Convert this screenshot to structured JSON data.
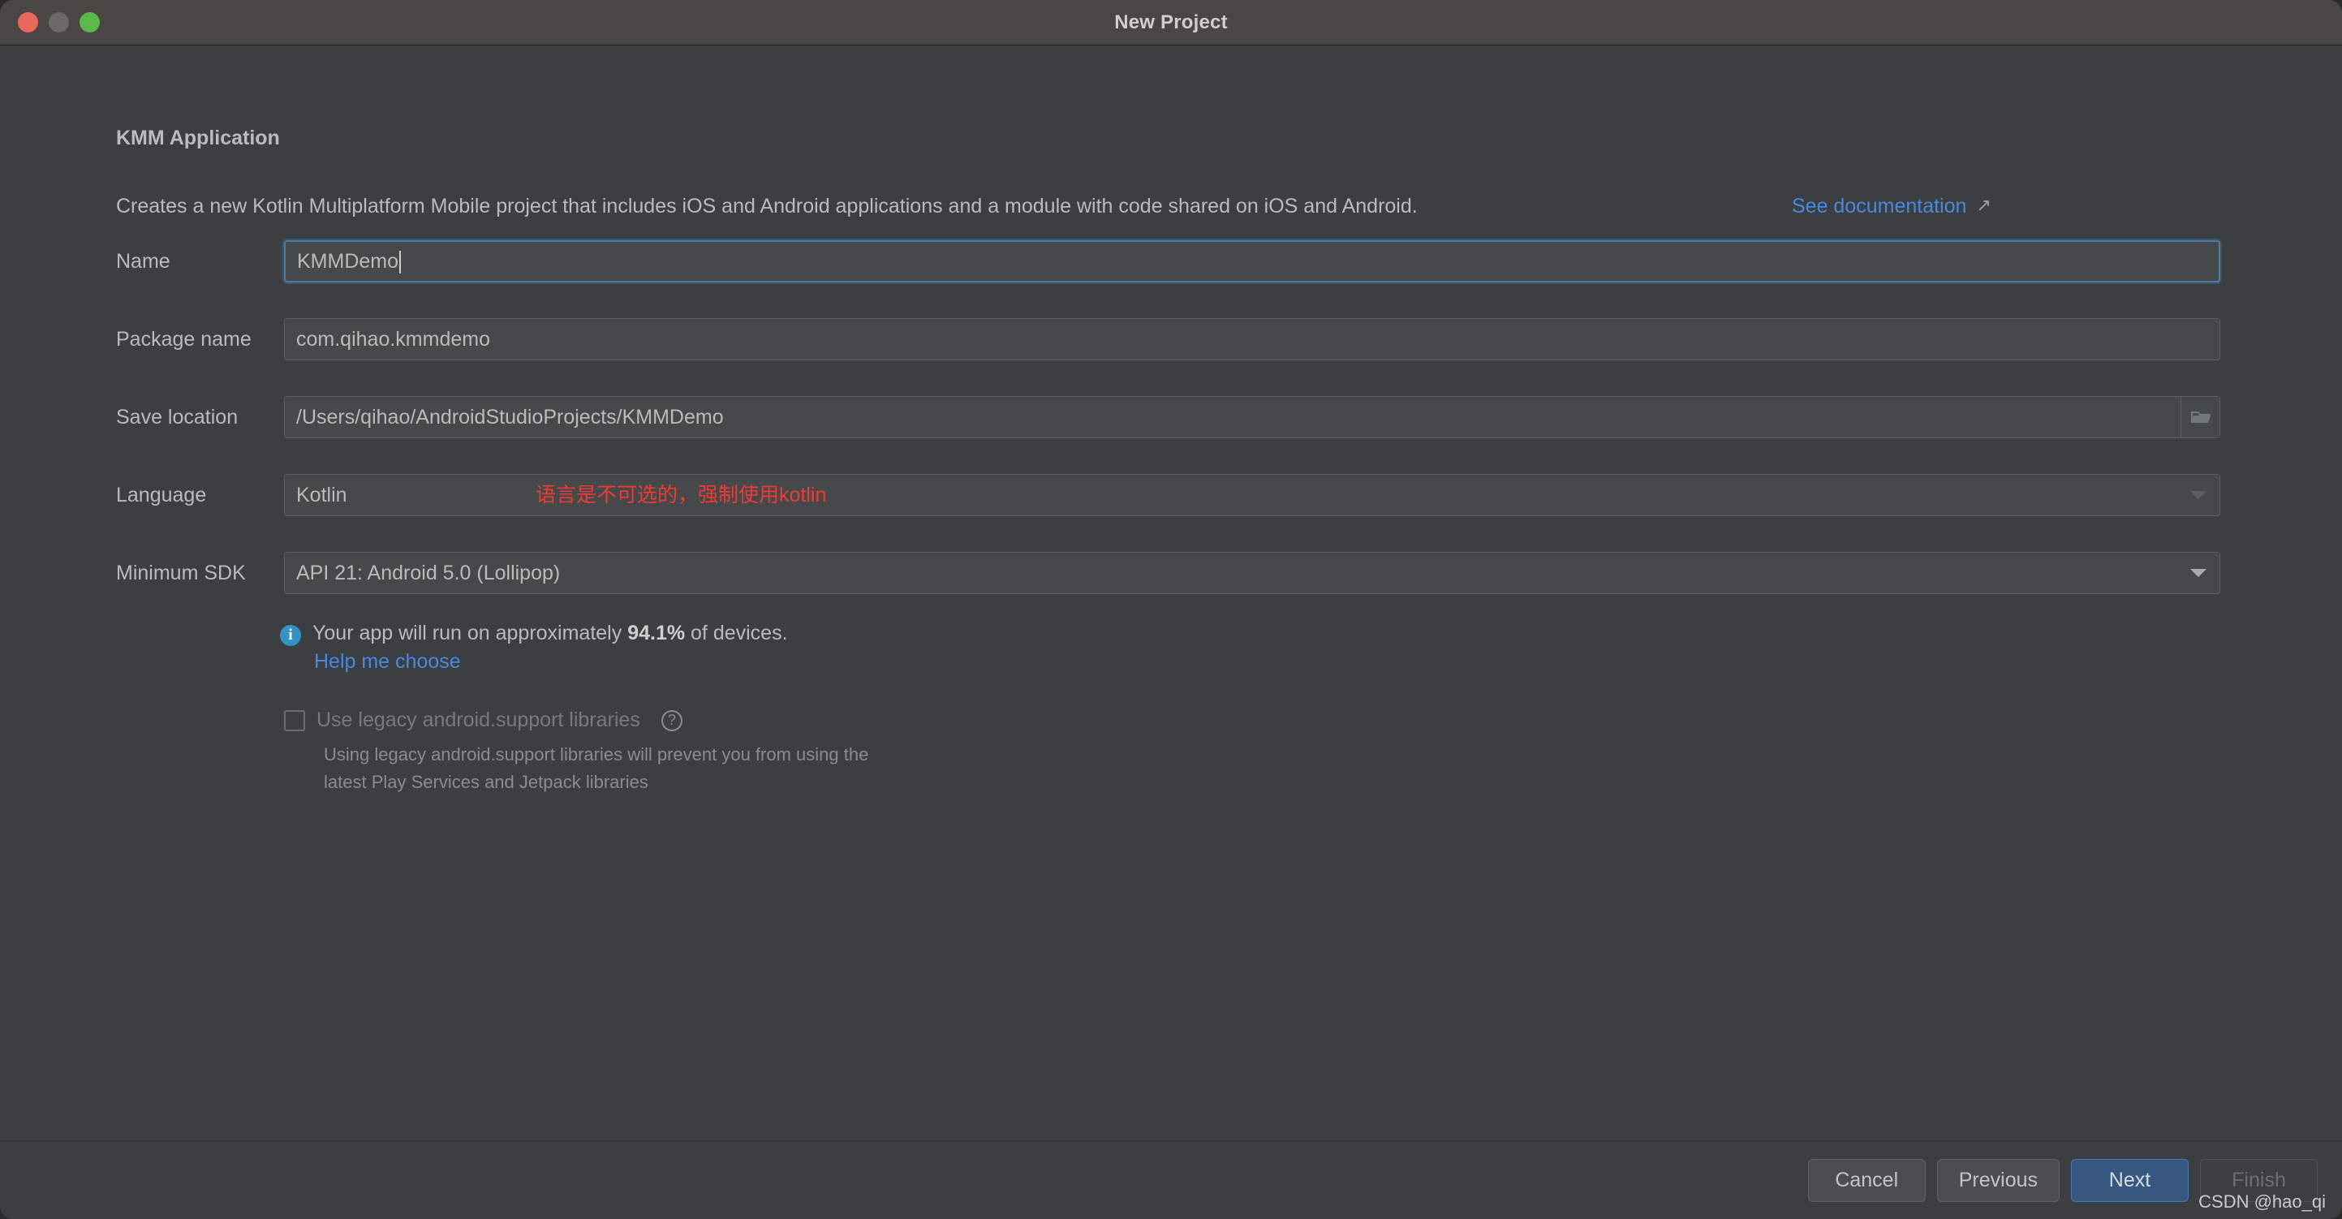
{
  "window": {
    "title": "New Project",
    "controls": {
      "close": "close-button",
      "minimize": "minimize-button",
      "maximize": "maximize-button"
    }
  },
  "page": {
    "title": "KMM Application",
    "description": "Creates a new Kotlin Multiplatform Mobile project that includes iOS and Android applications and a module with code shared on iOS and Android.",
    "doc_link": "See documentation",
    "doc_link_icon": "external-link-arrow"
  },
  "form": {
    "name": {
      "label": "Name",
      "value": "KMMDemo",
      "placeholder": "Name"
    },
    "package_name": {
      "label": "Package name",
      "value": "com.qihao.kmmdemo",
      "placeholder": "Package name"
    },
    "save_location": {
      "label": "Save location",
      "value": "/Users/qihao/AndroidStudioProjects/KMMDemo",
      "placeholder": "Save location",
      "browse_icon": "folder-icon"
    },
    "language": {
      "label": "Language",
      "value": "Kotlin",
      "options": [
        "Kotlin"
      ],
      "annotation": "语言是不可选的，强制使用kotlin",
      "annotation_color": "#f03a35",
      "disabled": true
    },
    "minimum_sdk": {
      "label": "Minimum SDK",
      "value": "API 21: Android 5.0 (Lollipop)",
      "options": [
        "API 21: Android 5.0 (Lollipop)"
      ]
    }
  },
  "info": {
    "icon": "info-icon",
    "text_before": "Your app will run on approximately ",
    "percent": "94.1%",
    "text_after": " of devices.",
    "help_link": "Help me choose"
  },
  "legacy": {
    "checkbox_label": "Use legacy android.support libraries",
    "checked": false,
    "help_icon": "question-mark-icon",
    "hint": "Using legacy android.support libraries will prevent you from using the latest Play Services and Jetpack libraries"
  },
  "footer": {
    "cancel": "Cancel",
    "previous": "Previous",
    "next": "Next",
    "finish": "Finish"
  },
  "watermark": "CSDN @hao_qi",
  "colors": {
    "accent_blue": "#4a88e0",
    "primary_button": "#365880",
    "info_blue": "#3592c4",
    "annotation_red": "#f03a35",
    "window_bg": "#3c3f41",
    "titlebar_bg": "#494644"
  }
}
